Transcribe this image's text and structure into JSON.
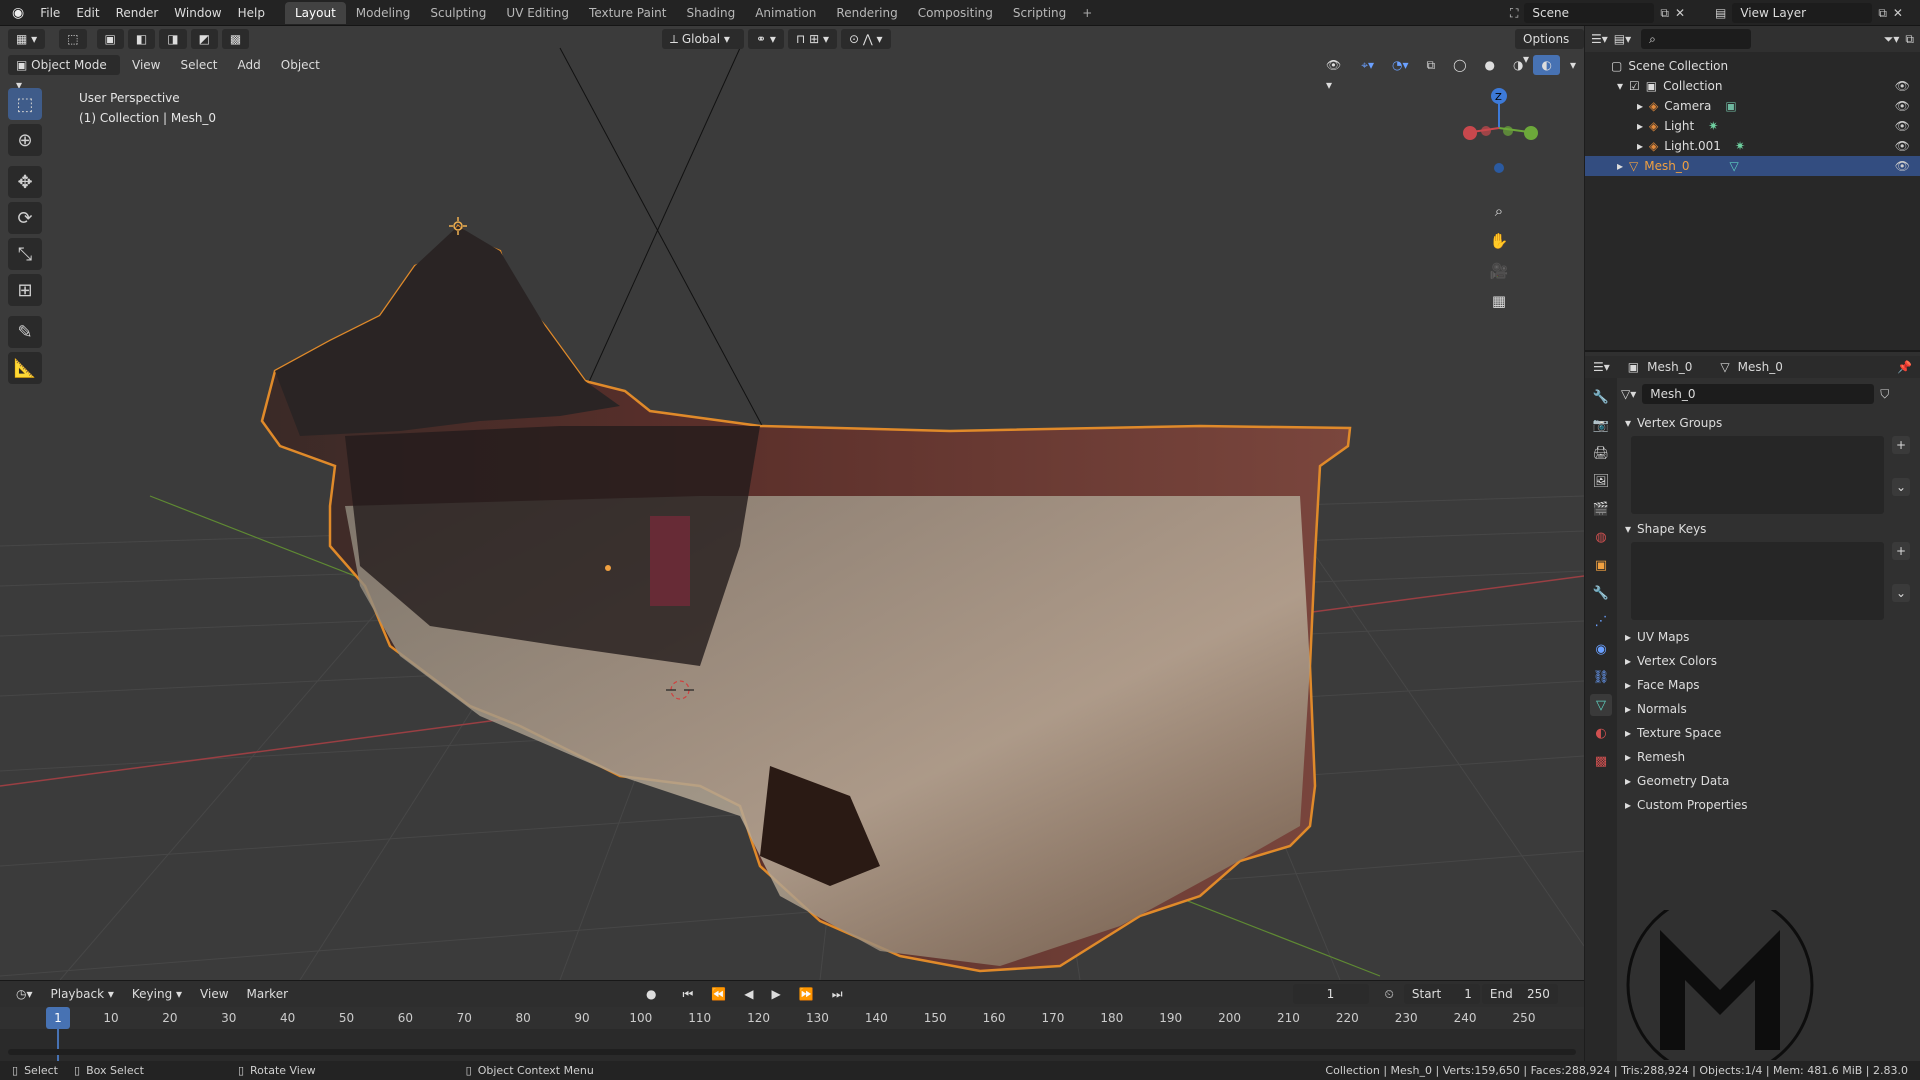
{
  "menu": [
    "File",
    "Edit",
    "Render",
    "Window",
    "Help"
  ],
  "workspaces": [
    "Layout",
    "Modeling",
    "Sculpting",
    "UV Editing",
    "Texture Paint",
    "Shading",
    "Animation",
    "Rendering",
    "Compositing",
    "Scripting"
  ],
  "scene_label": "Scene",
  "view_layer_label": "View Layer",
  "viewport": {
    "mode": "Object Mode",
    "menus": [
      "View",
      "Select",
      "Add",
      "Object"
    ],
    "transform_orientation": "Global",
    "options_label": "Options",
    "info_line1": "User Perspective",
    "info_line2": "(1) Collection | Mesh_0"
  },
  "outliner": {
    "root": "Scene Collection",
    "items": [
      {
        "label": "Collection"
      },
      {
        "label": "Camera"
      },
      {
        "label": "Light"
      },
      {
        "label": "Light.001"
      },
      {
        "label": "Mesh_0"
      }
    ]
  },
  "properties": {
    "breadcrumb_obj": "Mesh_0",
    "breadcrumb_data": "Mesh_0",
    "data_name": "Mesh_0",
    "open_panels": [
      "Vertex Groups",
      "Shape Keys"
    ],
    "closed_panels": [
      "UV Maps",
      "Vertex Colors",
      "Face Maps",
      "Normals",
      "Texture Space",
      "Remesh",
      "Geometry Data",
      "Custom Properties"
    ]
  },
  "timeline": {
    "menus": [
      "Playback",
      "Keying",
      "View",
      "Marker"
    ],
    "current_frame": "1",
    "start_label": "Start",
    "start_value": "1",
    "end_label": "End",
    "end_value": "250",
    "ticks": [
      "1",
      "10",
      "20",
      "30",
      "40",
      "50",
      "60",
      "70",
      "80",
      "90",
      "100",
      "110",
      "120",
      "130",
      "140",
      "150",
      "160",
      "170",
      "180",
      "190",
      "200",
      "210",
      "220",
      "230",
      "240",
      "250"
    ]
  },
  "status": {
    "select": "Select",
    "box_select": "Box Select",
    "rotate_view": "Rotate View",
    "context_menu": "Object Context Menu",
    "stats": "Collection | Mesh_0 | Verts:159,650 | Faces:288,924 | Tris:288,924 | Objects:1/4 | Mem: 481.6 MiB | 2.83.0"
  },
  "colors": {
    "selection_outline": "#e08a2a",
    "active_blue": "#334d80",
    "axis_red": "#c8484d",
    "axis_green": "#6ca83a",
    "axis_blue": "#3d7ad8"
  }
}
